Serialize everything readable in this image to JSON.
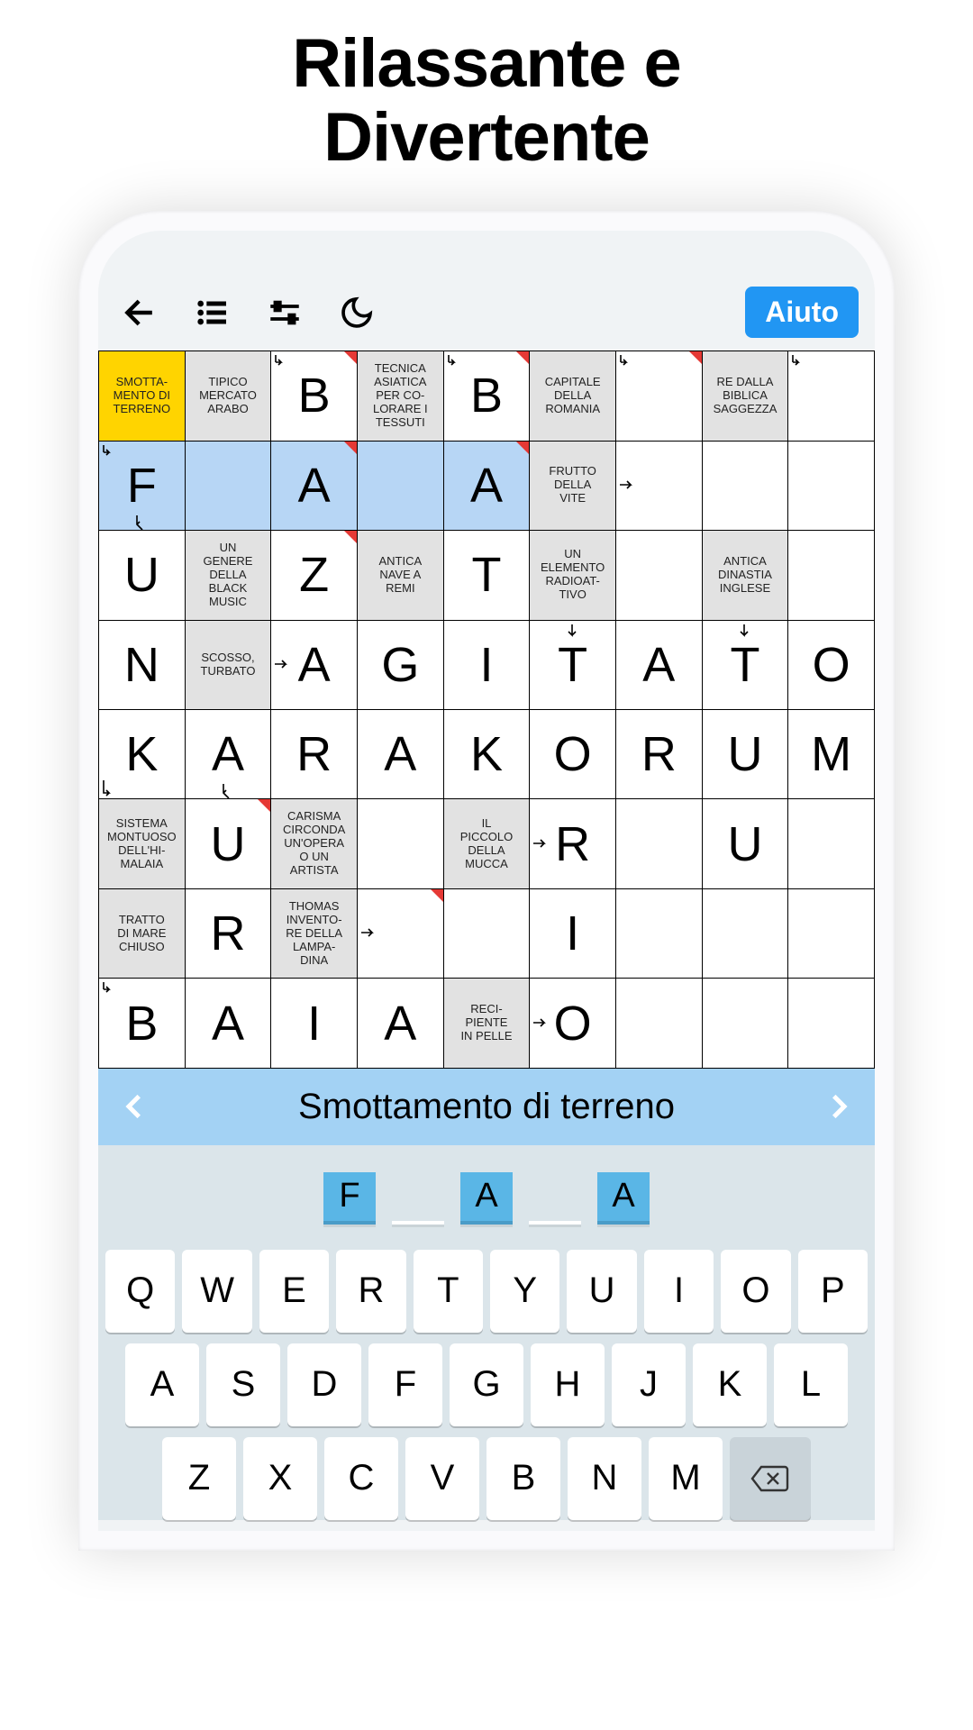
{
  "headline_line1": "Rilassante e",
  "headline_line2": "Divertente",
  "toolbar": {
    "help": "Aiuto"
  },
  "grid": {
    "rows": [
      [
        {
          "t": "clue",
          "sel": true,
          "text": "SMOTTA-\nMENTO DI\nTERRENO"
        },
        {
          "t": "clue",
          "text": "TIPICO\nMERCATO\nARABO"
        },
        {
          "t": "letter",
          "arrow": "tl",
          "v": "B",
          "red": true
        },
        {
          "t": "clue",
          "text": "TECNICA\nASIATICA\nPER CO-\nLORARE I\nTESSUTI"
        },
        {
          "t": "letter",
          "arrow": "tl",
          "v": "B",
          "red": true
        },
        {
          "t": "clue",
          "text": "CAPITALE\nDELLA\nROMANIA"
        },
        {
          "t": "letter",
          "arrow": "tl",
          "v": "",
          "red": true
        },
        {
          "t": "clue",
          "text": "RE DALLA\nBIBLICA\nSAGGEZZA"
        },
        {
          "t": "letter",
          "arrow": "tl",
          "v": ""
        }
      ],
      [
        {
          "t": "letter",
          "hl": true,
          "arrow": "tl",
          "v": "F",
          "diag": true
        },
        {
          "t": "letter",
          "hl": true,
          "v": ""
        },
        {
          "t": "letter",
          "hl": true,
          "v": "A",
          "red": true
        },
        {
          "t": "letter",
          "hl": true,
          "v": ""
        },
        {
          "t": "letter",
          "hl": true,
          "v": "A",
          "red": true
        },
        {
          "t": "clue",
          "text": "FRUTTO\nDELLA\nVITE"
        },
        {
          "t": "letter",
          "arrow": "lr",
          "v": ""
        },
        {
          "t": "letter",
          "v": ""
        },
        {
          "t": "letter",
          "v": ""
        }
      ],
      [
        {
          "t": "letter",
          "v": "U"
        },
        {
          "t": "clue",
          "text": "UN\nGENERE\nDELLA\nBLACK\nMUSIC"
        },
        {
          "t": "letter",
          "v": "Z",
          "red": true
        },
        {
          "t": "clue",
          "text": "ANTICA\nNAVE A\nREMI"
        },
        {
          "t": "letter",
          "v": "T"
        },
        {
          "t": "clue",
          "text": "UN\nELEMENTO\nRADIOAT-\nTIVO"
        },
        {
          "t": "letter",
          "v": ""
        },
        {
          "t": "clue",
          "text": "ANTICA\nDINASTIA\nINGLESE"
        },
        {
          "t": "letter",
          "v": ""
        }
      ],
      [
        {
          "t": "letter",
          "v": "N"
        },
        {
          "t": "clue",
          "text": "SCOSSO,\nTURBATO"
        },
        {
          "t": "letter",
          "arrow": "lr",
          "v": "A"
        },
        {
          "t": "letter",
          "v": "G"
        },
        {
          "t": "letter",
          "v": "I"
        },
        {
          "t": "letter",
          "arrow": "d",
          "v": "T"
        },
        {
          "t": "letter",
          "v": "A"
        },
        {
          "t": "letter",
          "arrow": "d",
          "v": "T"
        },
        {
          "t": "letter",
          "v": "O"
        }
      ],
      [
        {
          "t": "letter",
          "v": "K",
          "arrow_bl": true
        },
        {
          "t": "letter",
          "v": "A",
          "diag": true
        },
        {
          "t": "letter",
          "v": "R"
        },
        {
          "t": "letter",
          "v": "A"
        },
        {
          "t": "letter",
          "v": "K"
        },
        {
          "t": "letter",
          "v": "O"
        },
        {
          "t": "letter",
          "v": "R"
        },
        {
          "t": "letter",
          "v": "U"
        },
        {
          "t": "letter",
          "v": "M"
        }
      ],
      [
        {
          "t": "clue",
          "text": "SISTEMA\nMONTUOSO\nDELL'HI-\nMALAIA"
        },
        {
          "t": "letter",
          "v": "U",
          "red": true
        },
        {
          "t": "clue",
          "text": "CARISMA\nCIRCONDA\nUN'OPERA\nO UN\nARTISTA"
        },
        {
          "t": "letter",
          "v": ""
        },
        {
          "t": "clue",
          "text": "IL\nPICCOLO\nDELLA\nMUCCA"
        },
        {
          "t": "letter",
          "arrow": "lr",
          "v": "R"
        },
        {
          "t": "letter",
          "v": ""
        },
        {
          "t": "letter",
          "v": "U"
        },
        {
          "t": "letter",
          "v": ""
        }
      ],
      [
        {
          "t": "clue",
          "text": "TRATTO\nDI MARE\nCHIUSO"
        },
        {
          "t": "letter",
          "v": "R"
        },
        {
          "t": "clue",
          "text": "THOMAS\nINVENTO-\nRE DELLA\nLAMPA-\nDINA"
        },
        {
          "t": "letter",
          "arrow": "lr",
          "v": "",
          "red": true
        },
        {
          "t": "letter",
          "v": ""
        },
        {
          "t": "letter",
          "v": "I"
        },
        {
          "t": "letter",
          "v": ""
        },
        {
          "t": "letter",
          "v": ""
        },
        {
          "t": "letter",
          "v": ""
        }
      ],
      [
        {
          "t": "letter",
          "arrow": "tl",
          "v": "B"
        },
        {
          "t": "letter",
          "v": "A"
        },
        {
          "t": "letter",
          "v": "I"
        },
        {
          "t": "letter",
          "v": "A"
        },
        {
          "t": "clue",
          "text": "RECI-\nPIENTE\nIN PELLE"
        },
        {
          "t": "letter",
          "arrow": "lr",
          "v": "O"
        },
        {
          "t": "letter",
          "v": ""
        },
        {
          "t": "letter",
          "v": ""
        },
        {
          "t": "letter",
          "v": ""
        }
      ]
    ]
  },
  "hint": {
    "text": "Smottamento di terreno"
  },
  "answer": [
    {
      "v": "F",
      "filled": true
    },
    {
      "v": "",
      "filled": false
    },
    {
      "v": "A",
      "filled": true
    },
    {
      "v": "",
      "filled": false
    },
    {
      "v": "A",
      "filled": true
    }
  ],
  "keyboard": {
    "row1": [
      "Q",
      "W",
      "E",
      "R",
      "T",
      "Y",
      "U",
      "I",
      "O",
      "P"
    ],
    "row2": [
      "A",
      "S",
      "D",
      "F",
      "G",
      "H",
      "J",
      "K",
      "L"
    ],
    "row3": [
      "Z",
      "X",
      "C",
      "V",
      "B",
      "N",
      "M"
    ]
  }
}
